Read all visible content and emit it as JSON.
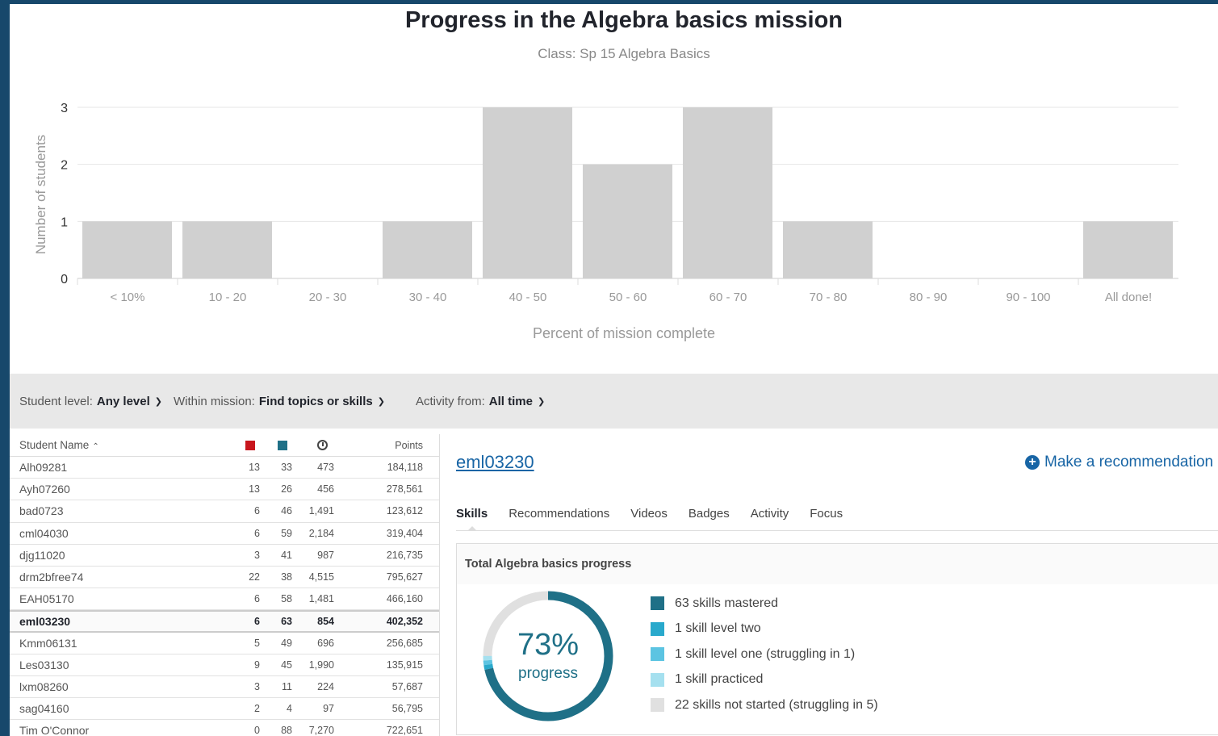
{
  "colors": {
    "bar": "#d0d0d0",
    "grid": "#e6e6e6",
    "axis_text": "#333333",
    "tick_text": "#999999",
    "accent_red": "#c8161d",
    "accent_teal": "#1f7087",
    "link": "#1865a5"
  },
  "chart_data": {
    "type": "bar",
    "title": "Progress in the Algebra basics mission",
    "subtitle": "Class: Sp 15 Algebra Basics",
    "xlabel": "Percent of mission complete",
    "ylabel": "Number of students",
    "categories": [
      "< 10%",
      "10 - 20",
      "20 - 30",
      "30 - 40",
      "40 - 50",
      "50 - 60",
      "60 - 70",
      "70 - 80",
      "80 - 90",
      "90 - 100",
      "All done!"
    ],
    "values": [
      1,
      1,
      0,
      1,
      3,
      2,
      3,
      1,
      0,
      0,
      1
    ],
    "ylim": [
      0,
      3
    ],
    "yticks": [
      0,
      1,
      2,
      3
    ],
    "grid": true
  },
  "filters": {
    "level_label": "Student level:",
    "level_value": "Any level",
    "mission_label": "Within mission:",
    "mission_value": "Find topics or skills",
    "activity_label": "Activity from:",
    "activity_value": "All time"
  },
  "table": {
    "name_header": "Student Name",
    "sort_icon": "caret-up-icon",
    "mastered_icon": "red-square-icon",
    "skills_icon": "teal-square-icon",
    "time_icon": "clock-icon",
    "points_header": "Points",
    "rows": [
      {
        "name": "Alh09281",
        "red": "13",
        "teal": "33",
        "time": "473",
        "points": "184,118"
      },
      {
        "name": "Ayh07260",
        "red": "13",
        "teal": "26",
        "time": "456",
        "points": "278,561"
      },
      {
        "name": "bad0723",
        "red": "6",
        "teal": "46",
        "time": "1,491",
        "points": "123,612"
      },
      {
        "name": "cml04030",
        "red": "6",
        "teal": "59",
        "time": "2,184",
        "points": "319,404"
      },
      {
        "name": "djg11020",
        "red": "3",
        "teal": "41",
        "time": "987",
        "points": "216,735"
      },
      {
        "name": "drm2bfree74",
        "red": "22",
        "teal": "38",
        "time": "4,515",
        "points": "795,627"
      },
      {
        "name": "EAH05170",
        "red": "6",
        "teal": "58",
        "time": "1,481",
        "points": "466,160"
      },
      {
        "name": "eml03230",
        "red": "6",
        "teal": "63",
        "time": "854",
        "points": "402,352",
        "selected": true
      },
      {
        "name": "Kmm06131",
        "red": "5",
        "teal": "49",
        "time": "696",
        "points": "256,685"
      },
      {
        "name": "Les03130",
        "red": "9",
        "teal": "45",
        "time": "1,990",
        "points": "135,915"
      },
      {
        "name": "lxm08260",
        "red": "3",
        "teal": "11",
        "time": "224",
        "points": "57,687"
      },
      {
        "name": "sag04160",
        "red": "2",
        "teal": "4",
        "time": "97",
        "points": "56,795"
      },
      {
        "name": "Tim O'Connor",
        "red": "0",
        "teal": "88",
        "time": "7,270",
        "points": "722,651"
      }
    ]
  },
  "detail": {
    "student": "eml03230",
    "recommend_label": "Make a recommendation",
    "tabs": [
      "Skills",
      "Recommendations",
      "Videos",
      "Badges",
      "Activity",
      "Focus"
    ],
    "active_tab": "Skills",
    "card_title": "Total Algebra basics progress",
    "donut_value": "73%",
    "donut_label": "progress",
    "donut_fraction": 0.73,
    "legend": [
      {
        "label": "63 skills mastered",
        "color": "#1f7087",
        "count": 63
      },
      {
        "label": "1 skill level two",
        "color": "#29a9cc",
        "count": 1
      },
      {
        "label": "1 skill level one (struggling in 1)",
        "color": "#5cc4e2",
        "count": 1
      },
      {
        "label": "1 skill practiced",
        "color": "#a5e0ef",
        "count": 1
      },
      {
        "label": "22 skills not started (struggling in 5)",
        "color": "#e0e0e0",
        "count": 22
      }
    ]
  }
}
